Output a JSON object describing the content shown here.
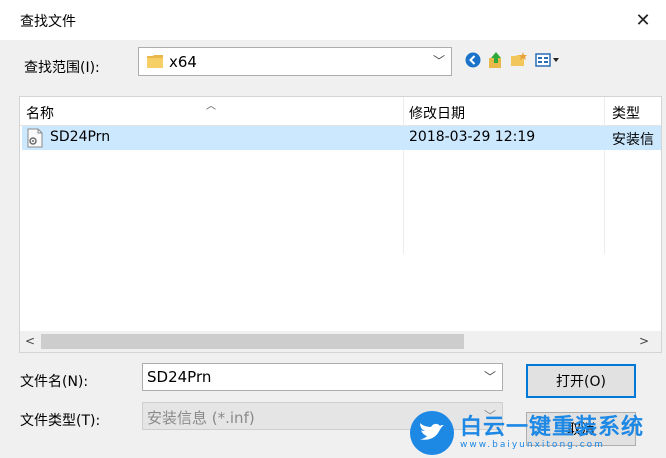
{
  "dialog": {
    "title": "查找文件",
    "close_glyph": "✕"
  },
  "look_in": {
    "label": "查找范围(I):",
    "value": "x64",
    "icon": "folder-icon"
  },
  "toolbar": {
    "icons": [
      "back-icon",
      "up-folder-icon",
      "new-folder-icon",
      "view-menu-icon"
    ]
  },
  "file_list": {
    "columns": [
      "名称",
      "修改日期",
      "类型"
    ],
    "rows": [
      {
        "name": "SD24Prn",
        "modified": "2018-03-29 12:19",
        "type": "安装信",
        "icon": "inf-file-icon"
      }
    ]
  },
  "file_name": {
    "label": "文件名(N):",
    "value": "SD24Prn"
  },
  "file_type": {
    "label": "文件类型(T):",
    "value": "安装信息 (*.inf)"
  },
  "buttons": {
    "open": "打开(O)",
    "cancel": "取消"
  },
  "watermark": {
    "main": "白云一键重装系统",
    "sub": "www.baiyunxitong.com"
  },
  "colors": {
    "selection": "#cce8ff",
    "accent": "#0078d7",
    "watermark": "#1e88e5"
  }
}
